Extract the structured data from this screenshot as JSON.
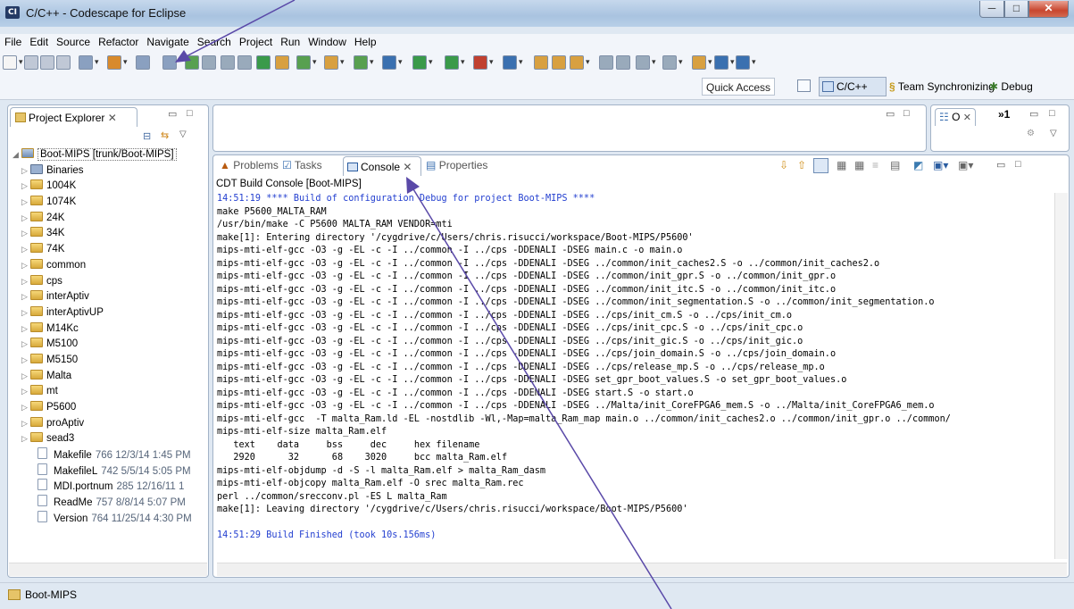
{
  "window": {
    "title": "C/C++ - Codescape for Eclipse",
    "app_icon": "CI",
    "minimize": "─",
    "maximize": "□",
    "close": "✕"
  },
  "menubar": [
    "File",
    "Edit",
    "Source",
    "Refactor",
    "Navigate",
    "Search",
    "Project",
    "Run",
    "Window",
    "Help"
  ],
  "toolbar": {
    "quick_access": "Quick Access",
    "perspectives": [
      "C/C++",
      "Team Synchronizing",
      "Debug"
    ]
  },
  "project_explorer": {
    "tab_label": "Project Explorer",
    "tree": [
      {
        "label": "Boot-MIPS [trunk/Boot-MIPS]",
        "type": "project",
        "expanded": true
      },
      {
        "label": "Binaries",
        "type": "binaries"
      },
      {
        "label": "1004K",
        "type": "folder"
      },
      {
        "label": "1074K",
        "type": "folder"
      },
      {
        "label": "24K",
        "type": "folder"
      },
      {
        "label": "34K",
        "type": "folder"
      },
      {
        "label": "74K",
        "type": "folder"
      },
      {
        "label": "common",
        "type": "folder"
      },
      {
        "label": "cps",
        "type": "folder"
      },
      {
        "label": "interAptiv",
        "type": "folder"
      },
      {
        "label": "interAptivUP",
        "type": "folder"
      },
      {
        "label": "M14Kc",
        "type": "folder"
      },
      {
        "label": "M5100",
        "type": "folder"
      },
      {
        "label": "M5150",
        "type": "folder"
      },
      {
        "label": "Malta",
        "type": "folder"
      },
      {
        "label": "mt",
        "type": "folder"
      },
      {
        "label": "P5600",
        "type": "folder"
      },
      {
        "label": "proAptiv",
        "type": "folder"
      },
      {
        "label": "sead3",
        "type": "folder"
      },
      {
        "label": "Makefile",
        "deco": "766  12/3/14 1:45 PM",
        "type": "file"
      },
      {
        "label": "MakefileL",
        "deco": "742  5/5/14 5:05 PM",
        "type": "file"
      },
      {
        "label": "MDI.portnum",
        "deco": "285  12/16/11 1",
        "type": "file"
      },
      {
        "label": "ReadMe",
        "deco": "757  8/8/14 5:07 PM",
        "type": "file"
      },
      {
        "label": "Version",
        "deco": "764  11/25/14 4:30 PM",
        "type": "file"
      }
    ]
  },
  "outline": {
    "tab_label": "O",
    "overflow": "»1"
  },
  "views": {
    "problems": "Problems",
    "tasks": "Tasks",
    "console": "Console",
    "properties": "Properties"
  },
  "console": {
    "title": "CDT Build Console [Boot-MIPS]",
    "lines": [
      {
        "text": "14:51:19 **** Build of configuration Debug for project Boot-MIPS ****",
        "color": "blue"
      },
      {
        "text": "make P5600_MALTA_RAM"
      },
      {
        "text": "/usr/bin/make -C P5600 MALTA_RAM VENDOR=mti"
      },
      {
        "text": "make[1]: Entering directory '/cygdrive/c/Users/chris.risucci/workspace/Boot-MIPS/P5600'"
      },
      {
        "text": "mips-mti-elf-gcc -O3 -g -EL -c -I ../common -I ../cps -DDENALI -DSEG main.c -o main.o"
      },
      {
        "text": "mips-mti-elf-gcc -O3 -g -EL -c -I ../common -I ../cps -DDENALI -DSEG ../common/init_caches2.S -o ../common/init_caches2.o"
      },
      {
        "text": "mips-mti-elf-gcc -O3 -g -EL -c -I ../common -I ../cps -DDENALI -DSEG ../common/init_gpr.S -o ../common/init_gpr.o"
      },
      {
        "text": "mips-mti-elf-gcc -O3 -g -EL -c -I ../common -I ../cps -DDENALI -DSEG ../common/init_itc.S -o ../common/init_itc.o"
      },
      {
        "text": "mips-mti-elf-gcc -O3 -g -EL -c -I ../common -I ../cps -DDENALI -DSEG ../common/init_segmentation.S -o ../common/init_segmentation.o"
      },
      {
        "text": "mips-mti-elf-gcc -O3 -g -EL -c -I ../common -I ../cps -DDENALI -DSEG ../cps/init_cm.S -o ../cps/init_cm.o"
      },
      {
        "text": "mips-mti-elf-gcc -O3 -g -EL -c -I ../common -I ../cps -DDENALI -DSEG ../cps/init_cpc.S -o ../cps/init_cpc.o"
      },
      {
        "text": "mips-mti-elf-gcc -O3 -g -EL -c -I ../common -I ../cps -DDENALI -DSEG ../cps/init_gic.S -o ../cps/init_gic.o"
      },
      {
        "text": "mips-mti-elf-gcc -O3 -g -EL -c -I ../common -I ../cps -DDENALI -DSEG ../cps/join_domain.S -o ../cps/join_domain.o"
      },
      {
        "text": "mips-mti-elf-gcc -O3 -g -EL -c -I ../common -I ../cps -DDENALI -DSEG ../cps/release_mp.S -o ../cps/release_mp.o"
      },
      {
        "text": "mips-mti-elf-gcc -O3 -g -EL -c -I ../common -I ../cps -DDENALI -DSEG set_gpr_boot_values.S -o set_gpr_boot_values.o"
      },
      {
        "text": "mips-mti-elf-gcc -O3 -g -EL -c -I ../common -I ../cps -DDENALI -DSEG start.S -o start.o"
      },
      {
        "text": "mips-mti-elf-gcc -O3 -g -EL -c -I ../common -I ../cps -DDENALI -DSEG ../Malta/init_CoreFPGA6_mem.S -o ../Malta/init_CoreFPGA6_mem.o"
      },
      {
        "text": "mips-mti-elf-gcc  -T malta_Ram.ld -EL -nostdlib -Wl,-Map=malta_Ram_map main.o ../common/init_caches2.o ../common/init_gpr.o ../common/"
      },
      {
        "text": "mips-mti-elf-size malta_Ram.elf"
      },
      {
        "text": "   text\t   data\t    bss\t    dec\t    hex\tfilename"
      },
      {
        "text": "   2920\t     32\t     68\t   3020\t    bcc\tmalta_Ram.elf"
      },
      {
        "text": "mips-mti-elf-objdump -d -S -l malta_Ram.elf > malta_Ram_dasm"
      },
      {
        "text": "mips-mti-elf-objcopy malta_Ram.elf -O srec malta_Ram.rec"
      },
      {
        "text": "perl ../common/srecconv.pl -ES L malta_Ram"
      },
      {
        "text": "make[1]: Leaving directory '/cygdrive/c/Users/chris.risucci/workspace/Boot-MIPS/P5600'"
      },
      {
        "text": ""
      },
      {
        "text": "14:51:29 Build Finished (took 10s.156ms)",
        "color": "blue"
      }
    ]
  },
  "status": {
    "text": "Boot-MIPS"
  },
  "colors": {
    "arrow": "#5a49a8",
    "console_blue": "#2440d0",
    "chrome": "#dfe8f2"
  }
}
